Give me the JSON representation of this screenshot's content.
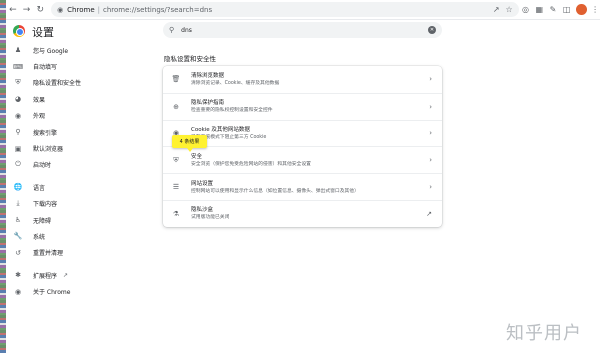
{
  "browser": {
    "chrome_label": "Chrome",
    "url": "chrome://settings/?search=dns"
  },
  "header": {
    "title": "设置"
  },
  "search": {
    "query": "dns"
  },
  "sidebar": {
    "items": [
      {
        "label": "您与 Google",
        "icon": "person-icon"
      },
      {
        "label": "自动填写",
        "icon": "autofill-icon"
      },
      {
        "label": "隐私设置和安全性",
        "icon": "shield-icon"
      },
      {
        "label": "效果",
        "icon": "performance-icon"
      },
      {
        "label": "外观",
        "icon": "palette-icon"
      },
      {
        "label": "搜索引擎",
        "icon": "search-icon"
      },
      {
        "label": "默认浏览器",
        "icon": "browser-icon"
      },
      {
        "label": "启动时",
        "icon": "power-icon"
      },
      {
        "label": "语言",
        "icon": "globe-icon"
      },
      {
        "label": "下载内容",
        "icon": "download-icon"
      },
      {
        "label": "无障碍",
        "icon": "accessibility-icon"
      },
      {
        "label": "系统",
        "icon": "wrench-icon"
      },
      {
        "label": "重置并清理",
        "icon": "reset-icon"
      },
      {
        "label": "扩展程序",
        "icon": "puzzle-icon"
      },
      {
        "label": "关于 Chrome",
        "icon": "chrome-icon"
      }
    ]
  },
  "main": {
    "section_title": "隐私设置和安全性",
    "rows": [
      {
        "title": "清除浏览数据",
        "subtitle": "清除浏览记录、Cookie、缓存及其他数据",
        "icon": "trash-icon"
      },
      {
        "title": "隐私保护指南",
        "subtitle": "检查重要的隐私权控制设置和安全控件",
        "icon": "guide-icon"
      },
      {
        "title": "Cookie 及其他网站数据",
        "subtitle": "已在无痕模式下阻止第三方 Cookie",
        "icon": "cookie-icon"
      },
      {
        "title": "安全",
        "subtitle": "安全浏览（保护您免受危险网站的侵害）和其他安全设置",
        "icon": "security-shield-icon"
      },
      {
        "title": "网站设置",
        "subtitle": "控制网站可以使用和显示什么信息（如位置信息、摄像头、弹出式窗口及其他）",
        "icon": "sliders-icon"
      },
      {
        "title": "隐私沙盒",
        "subtitle": "试用版功能已关闭",
        "icon": "flask-icon"
      }
    ],
    "tooltip": "4 条结果"
  },
  "watermark": "知乎用户",
  "colors": {
    "accent_blue": "#1a73e8",
    "tooltip_yellow": "#fff231",
    "avatar": "#e06030"
  }
}
